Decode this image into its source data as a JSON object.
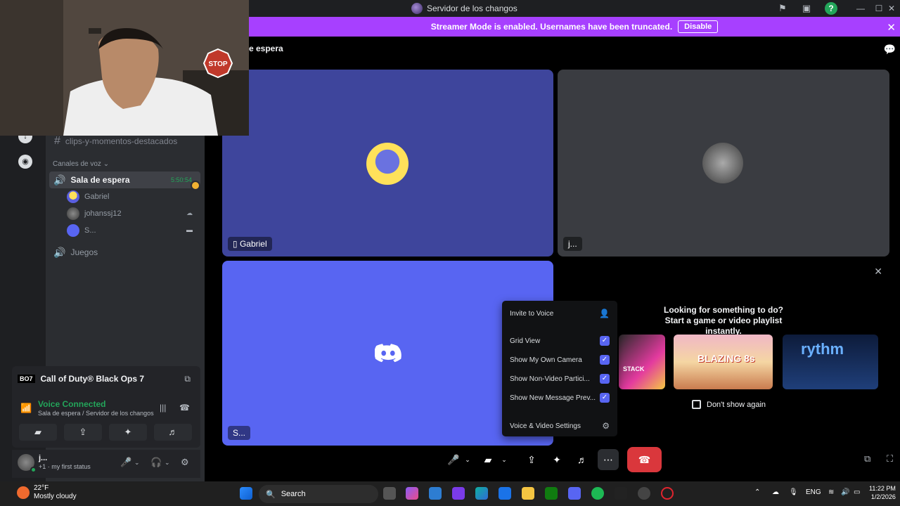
{
  "window": {
    "title": "Servidor de los changos"
  },
  "streamer_banner": {
    "message": "Streamer Mode is enabled. Usernames have been truncated.",
    "disable_label": "Disable"
  },
  "sidebar": {
    "text_channel": "clips-y-momentos-destacados",
    "voice_category": "Canales de voz",
    "voice_channels": [
      {
        "name": "Sala de espera",
        "timer": "5:50:54",
        "active": true
      },
      {
        "name": "Juegos",
        "active": false
      }
    ],
    "members": [
      {
        "name": "Gabriel"
      },
      {
        "name": "johanssj12"
      },
      {
        "name": "S..."
      }
    ]
  },
  "activity": {
    "badge": "BO7",
    "game": "Call of Duty® Black Ops 7"
  },
  "voice_panel": {
    "status": "Voice Connected",
    "location": "Sala de espera / Servidor de los changos"
  },
  "user_panel": {
    "name": "j...",
    "status": "+1 · my first status"
  },
  "stage": {
    "header": "e espera",
    "tiles": [
      {
        "name": "Gabriel"
      },
      {
        "name": "j..."
      },
      {
        "name": "S..."
      }
    ]
  },
  "activity_card": {
    "heading": "Looking for something to do?",
    "subheading": "Start a game or video playlist instantly.",
    "dont_show": "Don't show again",
    "thumbs": [
      "STACK",
      "BLAZING 8s",
      "rythm"
    ]
  },
  "menu": {
    "invite": "Invite to Voice",
    "grid_view": "Grid View",
    "show_own_camera": "Show My Own Camera",
    "show_non_video": "Show Non-Video Partici...",
    "show_new_message": "Show New Message Prev...",
    "av_settings": "Voice & Video Settings"
  },
  "taskbar": {
    "temp": "22°F",
    "weather": "Mostly cloudy",
    "search": "Search",
    "lang": "ENG",
    "time": "11:22 PM",
    "date": "1/2/2026"
  },
  "colors": {
    "blurple": "#5865f2",
    "streamer_purple": "#a740ff",
    "green": "#23a55a",
    "red": "#da373c"
  }
}
